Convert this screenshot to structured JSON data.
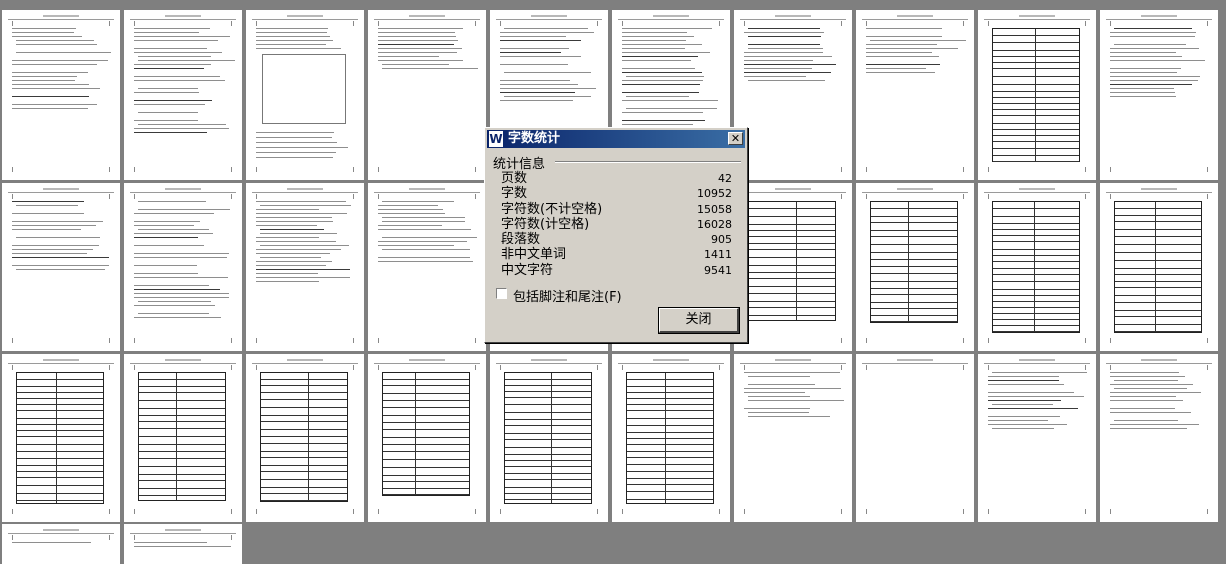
{
  "document_pages": {
    "count_shown": 32
  },
  "dialog": {
    "title": "字数统计",
    "app_icon_glyph": "W",
    "close_glyph": "✕",
    "group_label": "统计信息",
    "stats": [
      {
        "label": "页数",
        "value": "42"
      },
      {
        "label": "字数",
        "value": "10952"
      },
      {
        "label": "字符数(不计空格)",
        "value": "15058"
      },
      {
        "label": "字符数(计空格)",
        "value": "16028"
      },
      {
        "label": "段落数",
        "value": "905"
      },
      {
        "label": "非中文单词",
        "value": "1411"
      },
      {
        "label": "中文字符",
        "value": "9541"
      }
    ],
    "include_footnotes_label": "包括脚注和尾注(F)",
    "include_footnotes_checked": false,
    "close_button_label": "关闭"
  },
  "colors": {
    "workspace": "#7f7f7f",
    "title_bar_start": "#0a246a",
    "title_bar_end": "#3a6ea5",
    "dialog_face": "#d4d0c8"
  }
}
